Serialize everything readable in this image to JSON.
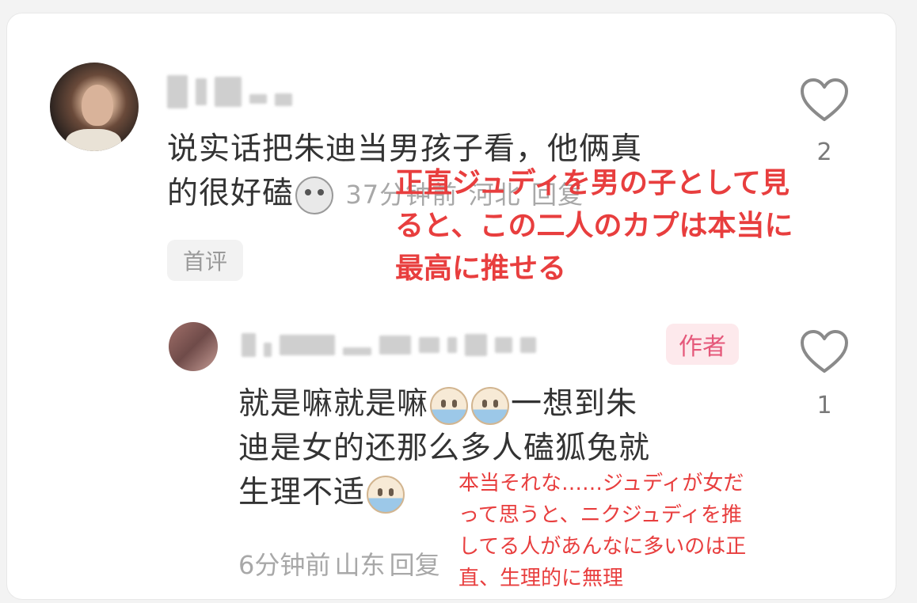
{
  "comment1": {
    "text_line1": "说实话把朱迪当男孩子看，他俩真",
    "text_line2": "的很好磕",
    "emoji": "cat-smile-emoji",
    "time": "37分钟前",
    "location": "河北",
    "reply_label": "回复",
    "tag": "首评",
    "likes": "2"
  },
  "comment2": {
    "author_badge": "作者",
    "text_line1_a": "就是嘛就是嘛",
    "text_line1_b": "一想到朱",
    "text_line2": "迪是女的还那么多人磕狐兔就",
    "text_line3": "生理不适",
    "emoji": "crying-emoji",
    "time": "6分钟前",
    "location": "山东",
    "reply_label": "回复",
    "likes": "1"
  },
  "translation1": {
    "line1": "正直ジュディを男の子として見",
    "line2": "ると、この二人のカプは本当に",
    "line3": "最高に推せる",
    "color": "#e83e3e"
  },
  "translation2": {
    "line1": "本当それな……ジュディが女だ",
    "line2": "って思うと、ニクジュディを推",
    "line3": "してる人があんなに多いのは正",
    "line4": "直、生理的に無理",
    "color": "#e83e3e"
  },
  "icons": {
    "like": "heart-outline-icon"
  }
}
